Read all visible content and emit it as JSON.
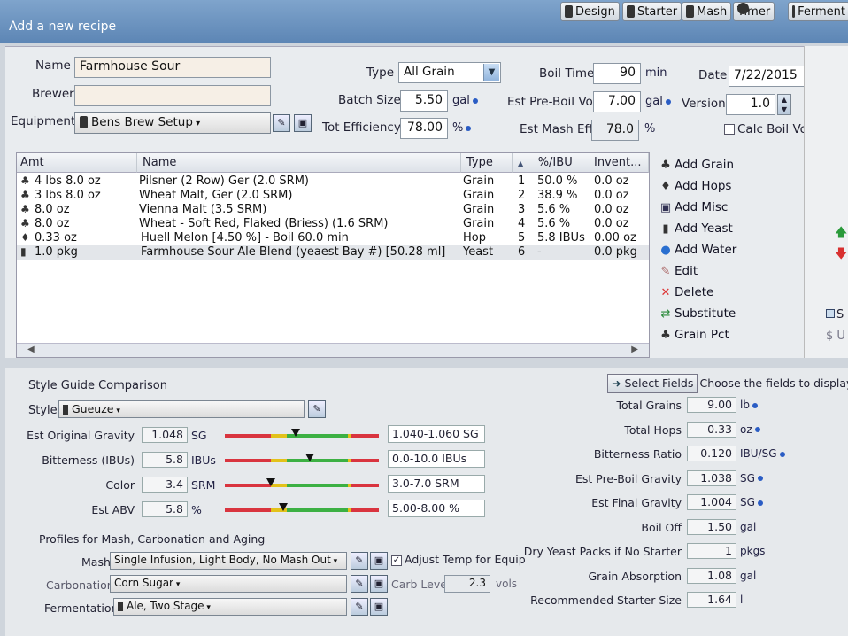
{
  "header": {
    "subtitle": "Add a new recipe",
    "toolbar": [
      {
        "label": "Design",
        "icon": "design-icon"
      },
      {
        "label": "Starter",
        "icon": "starter-icon"
      },
      {
        "label": "Mash",
        "icon": "mash-icon"
      },
      {
        "label": "Timer",
        "icon": "timer-icon"
      },
      {
        "label": "Ferment",
        "icon": "ferment-icon"
      }
    ]
  },
  "form": {
    "name_label": "Name",
    "name_value": "Farmhouse Sour",
    "brewer_label": "Brewer",
    "brewer_value": "",
    "equipment_label": "Equipment",
    "equipment_value": "Bens Brew Setup",
    "type_label": "Type",
    "type_value": "All Grain",
    "batch_label": "Batch Size",
    "batch_value": "5.50",
    "batch_unit": "gal",
    "eff_label": "Tot Efficiency",
    "eff_value": "78.00",
    "eff_unit": "%",
    "boil_time_label": "Boil Time",
    "boil_time_value": "90",
    "boil_time_unit": "min",
    "preboil_label": "Est Pre-Boil Vol",
    "preboil_value": "7.00",
    "preboil_unit": "gal",
    "mash_eff_label": "Est Mash Eff",
    "mash_eff_value": "78.0",
    "mash_eff_unit": "%",
    "date_label": "Date",
    "date_value": "7/22/2015",
    "version_label": "Version",
    "version_value": "1.0",
    "calc_boil_label": "Calc Boil Vol"
  },
  "ingredients": {
    "columns": [
      "Amt",
      "Name",
      "Type",
      "%/IBU",
      "Invent..."
    ],
    "rows": [
      {
        "amt": "4 lbs 8.0 oz",
        "name": "Pilsner (2 Row) Ger (2.0 SRM)",
        "type": "Grain",
        "num": "1",
        "pct": "50.0 %",
        "inv": "0.0 oz",
        "icon": "grain-icon"
      },
      {
        "amt": "3 lbs 8.0 oz",
        "name": "Wheat Malt, Ger (2.0 SRM)",
        "type": "Grain",
        "num": "2",
        "pct": "38.9 %",
        "inv": "0.0 oz",
        "icon": "grain-icon"
      },
      {
        "amt": "8.0 oz",
        "name": "Vienna Malt (3.5 SRM)",
        "type": "Grain",
        "num": "3",
        "pct": "5.6 %",
        "inv": "0.0 oz",
        "icon": "grain-icon"
      },
      {
        "amt": "8.0 oz",
        "name": "Wheat - Soft Red, Flaked (Briess) (1.6 SRM)",
        "type": "Grain",
        "num": "4",
        "pct": "5.6 %",
        "inv": "0.0 oz",
        "icon": "grain-icon"
      },
      {
        "amt": "0.33 oz",
        "name": "Huell Melon [4.50 %] - Boil 60.0 min",
        "type": "Hop",
        "num": "5",
        "pct": "5.8 IBUs",
        "inv": "0.00 oz",
        "icon": "hop-icon"
      },
      {
        "amt": "1.0 pkg",
        "name": "Farmhouse Sour Ale Blend (yeaest Bay #) [50.28 ml]",
        "type": "Yeast",
        "num": "6",
        "pct": "-",
        "inv": "0.0 pkg",
        "icon": "yeast-icon"
      }
    ]
  },
  "side_actions": [
    {
      "label": "Add Grain",
      "icon": "grain-icon"
    },
    {
      "label": "Add Hops",
      "icon": "hop-icon"
    },
    {
      "label": "Add Misc",
      "icon": "misc-icon"
    },
    {
      "label": "Add Yeast",
      "icon": "yeast-icon"
    },
    {
      "label": "Add Water",
      "icon": "water-icon"
    },
    {
      "label": "Edit",
      "icon": "edit-icon"
    },
    {
      "label": "Delete",
      "icon": "delete-icon"
    },
    {
      "label": "Substitute",
      "icon": "substitute-icon"
    },
    {
      "label": "Grain Pct",
      "icon": "grain-pct-icon"
    }
  ],
  "far_right": [
    "S",
    "U"
  ],
  "style_guide": {
    "title": "Style Guide Comparison",
    "style_label": "Style",
    "style_value": "Gueuze",
    "rows": [
      {
        "label": "Est Original Gravity",
        "value": "1.048",
        "unit": "SG",
        "range": "1.040-1.060 SG",
        "pos": 0.46
      },
      {
        "label": "Bitterness (IBUs)",
        "value": "5.8",
        "unit": "IBUs",
        "range": "0.0-10.0 IBUs",
        "pos": 0.55
      },
      {
        "label": "Color",
        "value": "3.4",
        "unit": "SRM",
        "range": "3.0-7.0 SRM",
        "pos": 0.3
      },
      {
        "label": "Est ABV",
        "value": "5.8",
        "unit": "%",
        "range": "5.00-8.00 %",
        "pos": 0.38
      }
    ]
  },
  "profiles": {
    "title": "Profiles for Mash, Carbonation and Aging",
    "mash_label": "Mash",
    "mash_value": "Single Infusion, Light Body, No Mash Out",
    "adjust_label": "Adjust Temp for Equip",
    "carb_label": "Carbonation",
    "carb_value": "Corn Sugar",
    "carb_level_label": "Carb Level",
    "carb_level_value": "2.3",
    "carb_level_unit": "vols",
    "ferm_label": "Fermentation",
    "ferm_value": "Ale, Two Stage"
  },
  "stats": {
    "select_label": "Select Fields",
    "select_hint": "- Choose the fields to display",
    "rows": [
      {
        "label": "Total Grains",
        "value": "9.00",
        "unit": "lb"
      },
      {
        "label": "Total Hops",
        "value": "0.33",
        "unit": "oz"
      },
      {
        "label": "Bitterness Ratio",
        "value": "0.120",
        "unit": "IBU/SG"
      },
      {
        "label": "Est Pre-Boil Gravity",
        "value": "1.038",
        "unit": "SG"
      },
      {
        "label": "Est Final Gravity",
        "value": "1.004",
        "unit": "SG"
      },
      {
        "label": "Boil Off",
        "value": "1.50",
        "unit": "gal"
      },
      {
        "label": "Dry Yeast Packs if No Starter",
        "value": "1",
        "unit": "pkgs"
      },
      {
        "label": "Grain Absorption",
        "value": "1.08",
        "unit": "gal"
      },
      {
        "label": "Recommended Starter Size",
        "value": "1.64",
        "unit": "l"
      }
    ]
  },
  "colors": {
    "header": "#5d86b5",
    "bar_green": "#3cb043",
    "bar_yellow": "#e3c21a",
    "bar_red": "#d9343f"
  }
}
